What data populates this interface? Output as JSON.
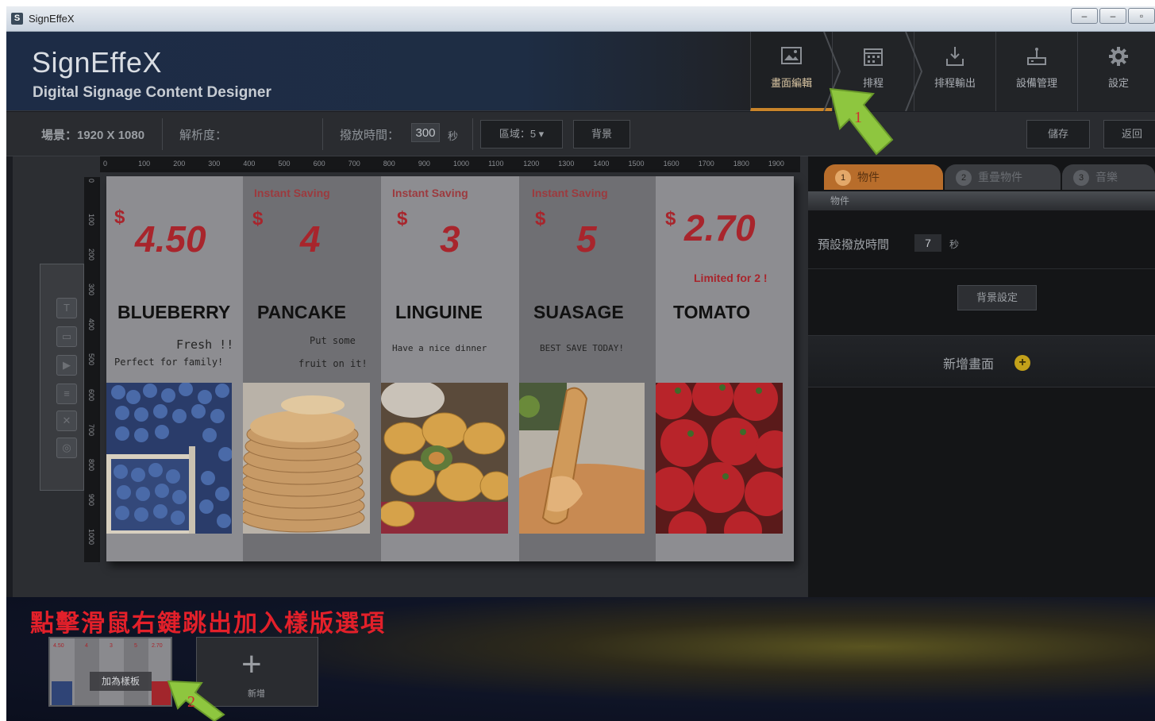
{
  "window": {
    "title": "SignEffeX",
    "app_icon_letter": "S",
    "controls": [
      "‒",
      "‒",
      "▫"
    ]
  },
  "header": {
    "logo": "SignEffeX",
    "subtitle": "Digital Signage Content Designer",
    "nav": [
      {
        "label": "畫面編輯",
        "icon": "screen-edit-icon",
        "active": true
      },
      {
        "label": "排程",
        "icon": "calendar-icon",
        "active": false
      },
      {
        "label": "排程輸出",
        "icon": "export-icon",
        "active": false
      },
      {
        "label": "設備管理",
        "icon": "device-icon",
        "active": false
      },
      {
        "label": "設定",
        "icon": "gear-icon",
        "active": false
      }
    ]
  },
  "toolbar": {
    "scene": "場景：1920 X 1080",
    "resolution": "解析度：",
    "play_time_label": "撥放時間：",
    "play_time_value": "300",
    "play_time_unit": "秒",
    "region_dropdown": "區域：5 ▾",
    "background_button": "背景",
    "save_button": "儲存",
    "back_button": "返回"
  },
  "ruler": {
    "h_ticks": [
      "0",
      "100",
      "200",
      "300",
      "400",
      "500",
      "600",
      "700",
      "800",
      "900",
      "1000",
      "1100",
      "1200",
      "1300",
      "1400",
      "1500",
      "1600",
      "1700",
      "1800",
      "1900"
    ],
    "v_ticks": [
      "0",
      "100",
      "200",
      "300",
      "400",
      "500",
      "600",
      "700",
      "800",
      "900",
      "1000"
    ]
  },
  "products": [
    {
      "saving": "",
      "dollar": "$",
      "price": "4.50",
      "limited": "",
      "name": "BLUEBERRY",
      "desc1": "Fresh !!",
      "desc2": "Perfect for family!",
      "image": "blueberries"
    },
    {
      "saving": "Instant Saving",
      "dollar": "$",
      "price": "4",
      "limited": "",
      "name": "PANCAKE",
      "desc1": "Put some",
      "desc2": "fruit on it!",
      "image": "pancakes"
    },
    {
      "saving": "Instant Saving",
      "dollar": "$",
      "price": "3",
      "limited": "",
      "name": "LINGUINE",
      "desc1": "Have a nice dinner",
      "desc2": "",
      "image": "pasta"
    },
    {
      "saving": "Instant Saving",
      "dollar": "$",
      "price": "5",
      "limited": "",
      "name": "SUASAGE",
      "desc1": "BEST SAVE TODAY!",
      "desc2": "",
      "image": "sausage"
    },
    {
      "saving": "",
      "dollar": "$",
      "price": "2.70",
      "limited": "Limited for 2 !",
      "name": "TOMATO",
      "desc1": "",
      "desc2": "",
      "image": "tomatoes"
    }
  ],
  "right_panel": {
    "tabs": [
      {
        "num": "1",
        "label": "物件",
        "active": true
      },
      {
        "num": "2",
        "label": "重疊物件",
        "active": false
      },
      {
        "num": "3",
        "label": "音樂",
        "active": false
      }
    ],
    "section_header": "物件",
    "default_time_label": "預設撥放時間",
    "default_time_value": "7",
    "default_time_unit": "秒",
    "bg_settings_button": "背景設定",
    "add_screen_label": "新增畫面",
    "add_icon": "+"
  },
  "bottom": {
    "instruction": "點擊滑鼠右鍵跳出加入樣版選項",
    "context_menu_item": "加為樣板",
    "thumb_prices": [
      "4.50",
      "4",
      "3",
      "5",
      "2.70"
    ],
    "add_new_icon": "+",
    "add_new_label": "新增"
  },
  "annotations": [
    {
      "label": "1",
      "color": "#8ec63f"
    },
    {
      "label": "2",
      "color": "#8ec63f"
    }
  ]
}
